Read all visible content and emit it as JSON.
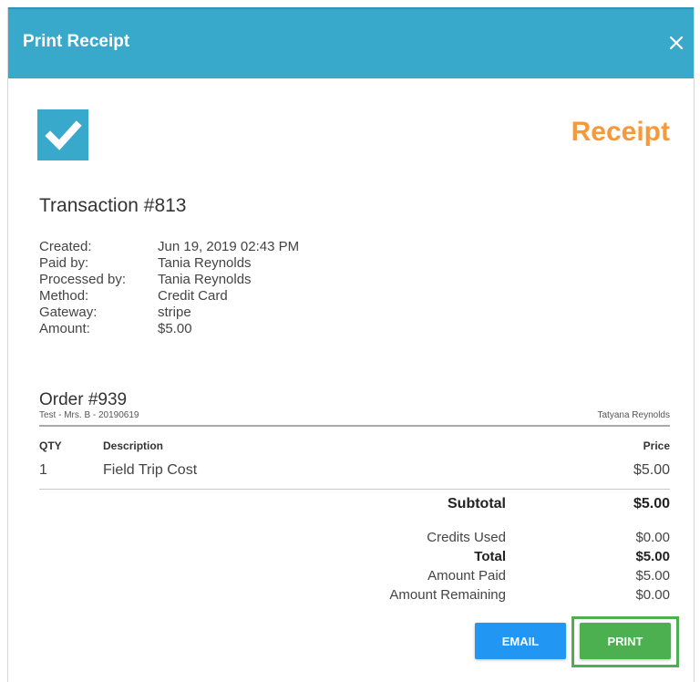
{
  "dialog": {
    "title": "Print Receipt",
    "close_icon": "close-icon",
    "accent_color": "#38a8cb"
  },
  "receipt": {
    "heading": "Receipt",
    "heading_color": "#f59a3b",
    "check_icon": "check-icon"
  },
  "transaction": {
    "title": "Transaction #813",
    "fields": [
      {
        "label": "Created:",
        "value": "Jun 19, 2019 02:43 PM"
      },
      {
        "label": "Paid by:",
        "value": "Tania Reynolds"
      },
      {
        "label": "Processed by:",
        "value": "Tania Reynolds"
      },
      {
        "label": "Method:",
        "value": "Credit Card"
      },
      {
        "label": "Gateway:",
        "value": "stripe"
      },
      {
        "label": "Amount:",
        "value": "$5.00"
      }
    ]
  },
  "order": {
    "title": "Order #939",
    "subtitle": "Test - Mrs. B - 20190619",
    "customer": "Tatyana Reynolds",
    "columns": {
      "qty": "QTY",
      "description": "Description",
      "price": "Price"
    },
    "items": [
      {
        "qty": "1",
        "description": "Field Trip Cost",
        "price": "$5.00"
      }
    ],
    "subtotal_label": "Subtotal",
    "subtotal_value": "$5.00",
    "totals": [
      {
        "label": "Credits Used",
        "value": "$0.00"
      },
      {
        "label": "Total",
        "value": "$5.00"
      },
      {
        "label": "Amount Paid",
        "value": "$5.00"
      },
      {
        "label": "Amount Remaining",
        "value": "$0.00"
      }
    ]
  },
  "actions": {
    "email_label": "EMAIL",
    "print_label": "PRINT",
    "email_color": "#2196f3",
    "print_color": "#4caf50"
  }
}
